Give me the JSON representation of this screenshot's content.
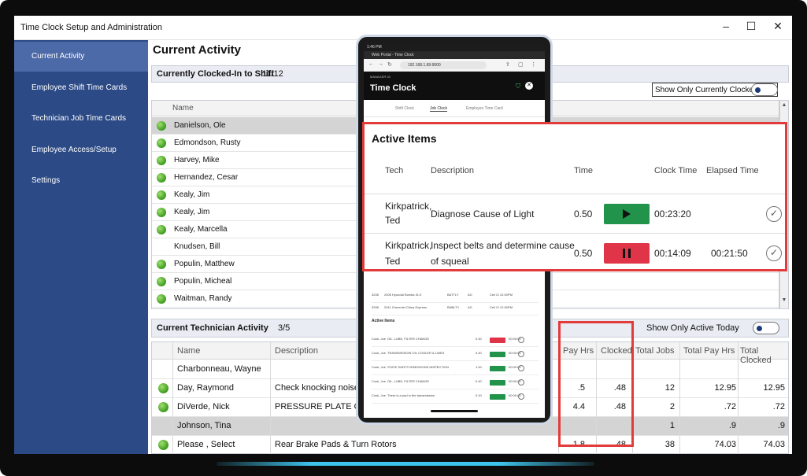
{
  "window": {
    "title": "Time Clock Setup and Administration",
    "controls": {
      "minimize": "–",
      "maximize": "☐",
      "close": "✕"
    }
  },
  "sidebar": {
    "items": [
      {
        "label": "Current Activity",
        "active": true
      },
      {
        "label": "Employee Shift Time Cards",
        "active": false
      },
      {
        "label": "Technician Job Time Cards",
        "active": false
      },
      {
        "label": "Employee Access/Setup",
        "active": false
      },
      {
        "label": "Settings",
        "active": false
      }
    ]
  },
  "main": {
    "title": "Current Activity",
    "clocked_in": {
      "label": "Currently Clocked-In to Shift",
      "count": "11/12",
      "filter_label": "Show Only Currently Clocked-In",
      "column": "Name",
      "rows": [
        {
          "name": "Danielson, Ole",
          "active": true,
          "selected": true
        },
        {
          "name": "Edmondson, Rusty",
          "active": true
        },
        {
          "name": "Harvey, Mike",
          "active": true
        },
        {
          "name": "Hernandez, Cesar",
          "active": true
        },
        {
          "name": "Kealy, Jim",
          "active": true
        },
        {
          "name": "Kealy, Jim",
          "active": true
        },
        {
          "name": "Kealy, Marcella",
          "active": true
        },
        {
          "name": "Knudsen, Bill",
          "active": false
        },
        {
          "name": "Populin, Matthew",
          "active": true
        },
        {
          "name": "Populin, Micheal",
          "active": true
        },
        {
          "name": "Waitman, Randy",
          "active": true
        }
      ]
    },
    "tech_activity": {
      "label": "Current Technician Activity",
      "count": "3/5",
      "filter_label": "Show Only Active Today",
      "columns": {
        "name": "Name",
        "description": "Description",
        "pay_hrs": "Pay Hrs",
        "clocked": "Clocked",
        "total_jobs": "Total Jobs",
        "total_pay_hrs": "Total Pay Hrs",
        "total_clocked": "Total Clocked"
      },
      "rows": [
        {
          "name": "Charbonneau, Wayne",
          "active": false,
          "description": "",
          "pay_hrs": "",
          "clocked": "",
          "total_jobs": "",
          "total_pay_hrs": "",
          "total_clocked": ""
        },
        {
          "name": "Day, Raymond",
          "active": true,
          "description": "Check knocking noise",
          "pay_hrs": ".5",
          "clocked": ".48",
          "total_jobs": "12",
          "total_pay_hrs": "12.95",
          "total_clocked": "12.95"
        },
        {
          "name": "DiVerde, Nick",
          "active": true,
          "description": "PRESSURE PLATE OR",
          "pay_hrs": "4.4",
          "clocked": ".48",
          "total_jobs": "2",
          "total_pay_hrs": ".72",
          "total_clocked": ".72"
        },
        {
          "name": "Johnson, Tina",
          "active": false,
          "selected": true,
          "description": "",
          "pay_hrs": "",
          "clocked": "",
          "total_jobs": "1",
          "total_pay_hrs": ".9",
          "total_clocked": ".9"
        },
        {
          "name": "Please , Select",
          "active": true,
          "description": "Rear Brake Pads & Turn Rotors",
          "pay_hrs": "1.8",
          "clocked": ".48",
          "total_jobs": "38",
          "total_pay_hrs": "74.03",
          "total_clocked": "74.03"
        }
      ]
    }
  },
  "tablet": {
    "status_time": "1:46 PM",
    "tab_title": "Web Portal - Time Clock",
    "url": "192.168.1.89:9000",
    "manager_label": "MANAGER 03",
    "app_title": "Time Clock",
    "nav": [
      "Shift Clock",
      "Job Clock",
      "Employee Time Card"
    ],
    "mini_rows": [
      {
        "col1": "3208",
        "col2": "2005 Hyundai Elantra XLS",
        "col3": "BATTLY",
        "col4": "AG",
        "col5": "Cell Cl 12:00PM"
      },
      {
        "col1": "3208",
        "col2": "2011 Chevrolet China Express",
        "col3": "BNBLTY",
        "col4": "AG",
        "col5": "Cell Cl 12:00PM"
      }
    ],
    "mini_heading": "Active Items",
    "mini_items": [
      {
        "tech": "Cook, Joe",
        "desc": "OIL, LUBE, FILTER CHANGE",
        "time": "0.40",
        "state": "stop",
        "elapsed": "00:00:00"
      },
      {
        "tech": "Cook, Joe",
        "desc": "TRANSMISSION OIL COOLER & LINES",
        "time": "0.40",
        "state": "play",
        "elapsed": "00:00:00"
      },
      {
        "tech": "Cook, Joe",
        "desc": "STATE SAFETY/EMISSIONS INSPECTION",
        "time": "1.00",
        "state": "play",
        "elapsed": "00:00:00"
      },
      {
        "tech": "Cook, Joe",
        "desc": "OIL, LUBE, FILTER CHANGE",
        "time": "0.40",
        "state": "play",
        "elapsed": "00:00:00"
      },
      {
        "tech": "Cook, Joe",
        "desc": "There is a pad in the transmission",
        "time": "0.10",
        "state": "play",
        "elapsed": "00:00:00"
      }
    ]
  },
  "active_items": {
    "title": "Active Items",
    "columns": {
      "tech": "Tech",
      "description": "Description",
      "time": "Time",
      "clock_time": "Clock Time",
      "elapsed_time": "Elapsed Time"
    },
    "rows": [
      {
        "tech_line1": "Kirkpatrick,",
        "tech_line2": "Ted",
        "desc_line1": "Diagnose Cause of Light",
        "desc_line2": "",
        "time": "0.50",
        "state": "play",
        "clock_time": "00:23:20",
        "elapsed_time": ""
      },
      {
        "tech_line1": "Kirkpatrick,",
        "tech_line2": "Ted",
        "desc_line1": "Inspect belts and determine cause",
        "desc_line2": "of squeal",
        "time": "0.50",
        "state": "stop",
        "clock_time": "00:14:09",
        "elapsed_time": "00:21:50"
      }
    ]
  },
  "colors": {
    "sidebar": "#2c4a86",
    "sidebar_active": "#4d6aa8",
    "highlight": "#e23b3b",
    "play": "#21934a",
    "stop": "#e03548",
    "status_green": "#3c9a1e"
  }
}
